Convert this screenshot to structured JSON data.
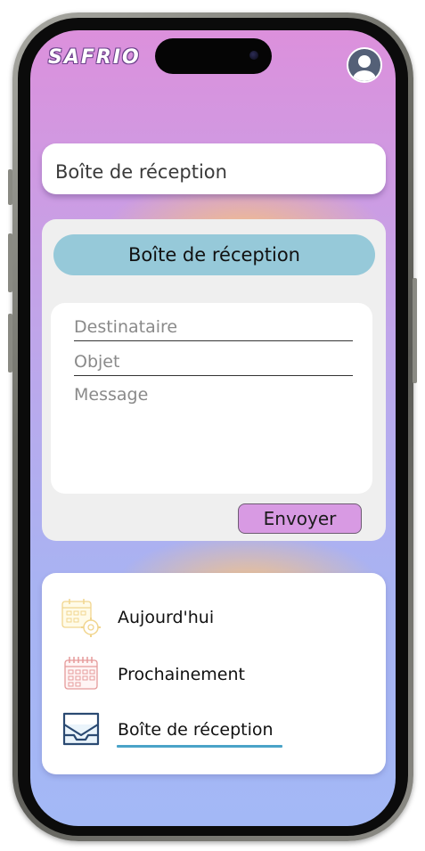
{
  "app": {
    "logo_text": "SAFRIO",
    "accent_color": "#96c9d9",
    "send_color": "#d89ae3"
  },
  "header": {
    "avatar_icon": "user-avatar-icon"
  },
  "title_card": {
    "label": "Boîte de réception"
  },
  "compose": {
    "header_label": "Boîte de réception",
    "recipient_placeholder": "Destinataire",
    "subject_placeholder": "Objet",
    "message_placeholder": "Message",
    "send_label": "Envoyer"
  },
  "nav": {
    "items": [
      {
        "label": "Aujourd'hui",
        "icon": "calendar-gear-icon"
      },
      {
        "label": "Prochainement",
        "icon": "calendar-icon"
      },
      {
        "label": "Boîte de réception",
        "icon": "inbox-icon",
        "active": true
      }
    ]
  }
}
